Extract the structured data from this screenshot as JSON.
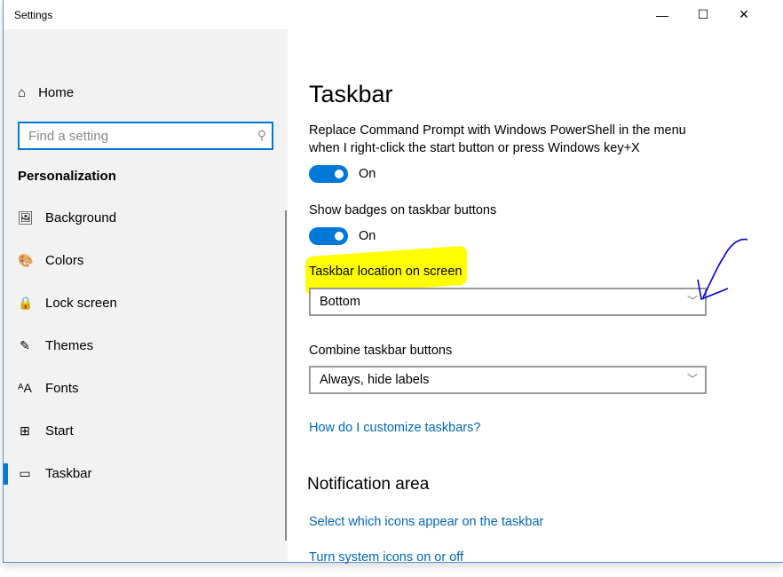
{
  "window": {
    "title": "Settings",
    "minimize": "—",
    "maximize": "☐",
    "close": "✕"
  },
  "sidebar": {
    "home": "Home",
    "search_placeholder": "Find a setting",
    "section": "Personalization",
    "items": [
      {
        "label": "Background",
        "icon": "image-icon",
        "glyph": "🖼"
      },
      {
        "label": "Colors",
        "icon": "palette-icon",
        "glyph": "🎨"
      },
      {
        "label": "Lock screen",
        "icon": "lock-screen-icon",
        "glyph": "🔒"
      },
      {
        "label": "Themes",
        "icon": "themes-icon",
        "glyph": "✎"
      },
      {
        "label": "Fonts",
        "icon": "fonts-icon",
        "glyph": "ᴬA"
      },
      {
        "label": "Start",
        "icon": "start-icon",
        "glyph": "⊞"
      },
      {
        "label": "Taskbar",
        "icon": "taskbar-icon",
        "glyph": "▭"
      }
    ],
    "active": "Taskbar"
  },
  "main": {
    "title": "Taskbar",
    "powershell_label": "Replace Command Prompt with Windows PowerShell in the menu",
    "powershell_label2": "when I right-click the start button or press Windows key+X",
    "powershell_state": "On",
    "badges_label": "Show badges on taskbar buttons",
    "badges_state": "On",
    "location_label": "Taskbar location on screen",
    "location_value": "Bottom",
    "combine_label": "Combine taskbar buttons",
    "combine_value": "Always, hide labels",
    "help_link": "How do I customize taskbars?",
    "notification_heading": "Notification area",
    "link_icons": "Select which icons appear on the taskbar",
    "link_system": "Turn system icons on or off"
  },
  "colors": {
    "accent": "#0078d7",
    "highlight": "#ffff00",
    "annotation": "#0000e0"
  }
}
